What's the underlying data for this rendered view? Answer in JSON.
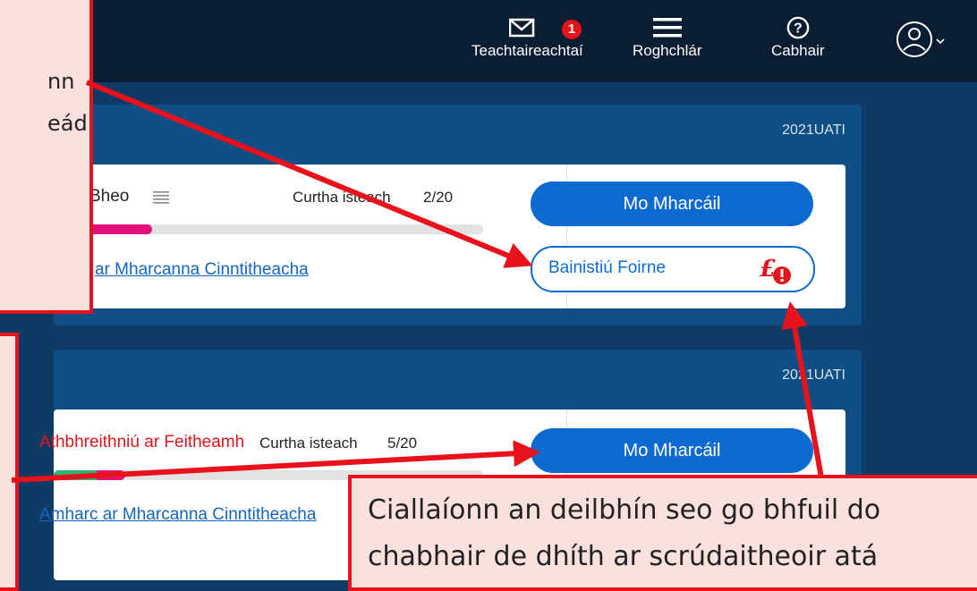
{
  "topbar": {
    "messages_label": "Teachtaireachtaí",
    "messages_badge": "1",
    "menu_label": "Roghchlár",
    "help_label": "Cabhair"
  },
  "panel_1": {
    "code": "2021UATI",
    "title_fragment": "Bheo",
    "submitted_label": "Curtha isteach",
    "submitted_count": "2/20",
    "progress_fraction": 0.13,
    "link_text": "ar Mharcanna Cinntitheacha",
    "primary_button": "Mo Mharcáil",
    "manage_button": "Bainistiú Foirne"
  },
  "panel_2": {
    "code": "2021UATI",
    "title_fragment": "Athbhreithniú ar Feitheamh",
    "submitted_label": "Curtha isteach",
    "submitted_count": "5/20",
    "progress_fraction": 0.28,
    "link_text": "Amharc ar Mharcanna Cinntitheacha",
    "primary_button": "Mo Mharcáil"
  },
  "callouts": {
    "top_left_line1": "nn",
    "top_left_line2": "eád",
    "bottom_right_line1": "Ciallaíonn an deilbhín seo go bhfuil do",
    "bottom_right_line2": "chabhair de dhíth ar scrúdaitheoir atá"
  },
  "colors": {
    "topbar": "#0b1d33",
    "background": "#0d3b66",
    "accent": "#0c6ad0",
    "alert": "#e3141b",
    "pending_text": "#e3141b",
    "callout_border": "#e8121c",
    "callout_fill": "#fbe1de"
  }
}
